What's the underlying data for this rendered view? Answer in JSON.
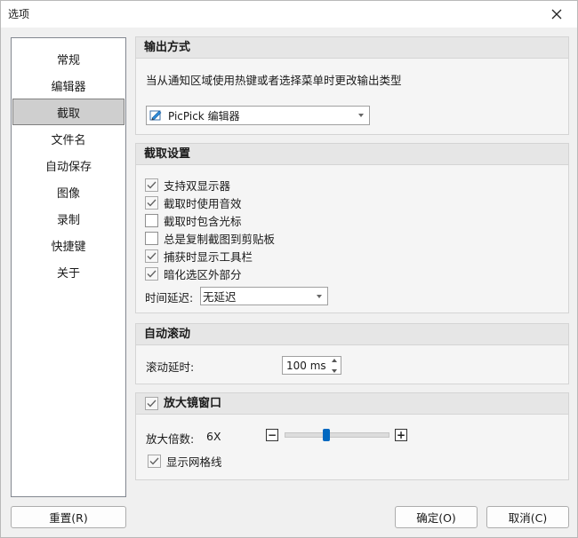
{
  "window": {
    "title": "选项"
  },
  "sidebar": {
    "items": [
      {
        "label": "常规"
      },
      {
        "label": "编辑器"
      },
      {
        "label": "截取",
        "active": true
      },
      {
        "label": "文件名"
      },
      {
        "label": "自动保存"
      },
      {
        "label": "图像"
      },
      {
        "label": "录制"
      },
      {
        "label": "快捷键"
      },
      {
        "label": "关于"
      }
    ]
  },
  "output": {
    "header": "输出方式",
    "description": "当从通知区域使用热键或者选择菜单时更改输出类型",
    "selected": "PicPick 编辑器",
    "icon": "picpick-editor-icon"
  },
  "capture": {
    "header": "截取设置",
    "options": [
      {
        "label": "支持双显示器",
        "checked": true
      },
      {
        "label": "截取时使用音效",
        "checked": true
      },
      {
        "label": "截取时包含光标",
        "checked": false
      },
      {
        "label": "总是复制截图到剪贴板",
        "checked": false
      },
      {
        "label": "捕获时显示工具栏",
        "checked": true
      },
      {
        "label": "暗化选区外部分",
        "checked": true
      }
    ],
    "delay_label": "时间延迟:",
    "delay_value": "无延迟"
  },
  "autoscroll": {
    "header": "自动滚动",
    "delay_label": "滚动延时:",
    "delay_value": "100 ms"
  },
  "magnifier": {
    "header": "放大镜窗口",
    "enabled": true,
    "zoom_label": "放大倍数:",
    "zoom_value": "6X",
    "zoom_level": 0.4,
    "minus": "−",
    "plus": "+",
    "grid_label": "显示网格线",
    "grid_checked": true
  },
  "buttons": {
    "reset": "重置(R)",
    "ok": "确定(O)",
    "cancel": "取消(C)"
  },
  "colors": {
    "accent": "#0067c0",
    "selected_bg": "#cfcfcf"
  }
}
